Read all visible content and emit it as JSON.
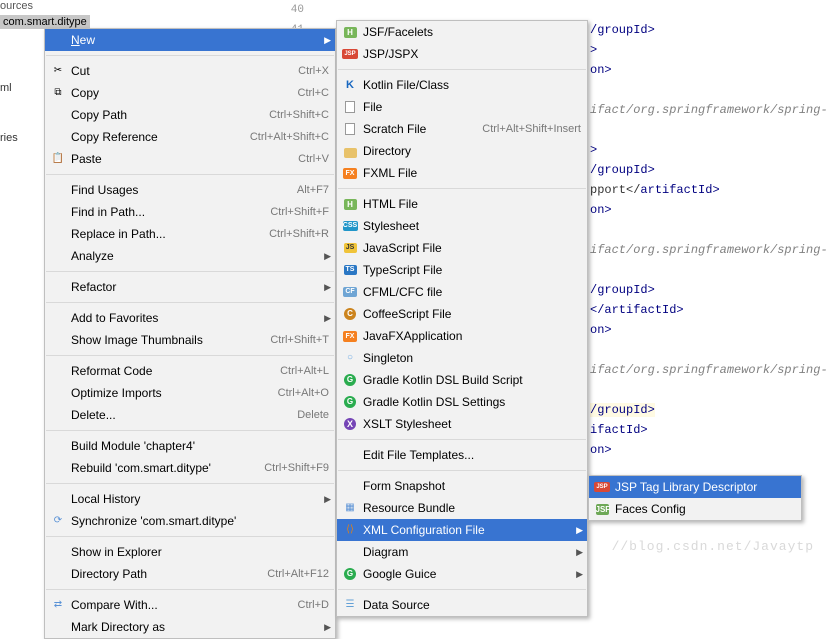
{
  "tree": {
    "sources": "ources",
    "selected_package": "com.smart.ditype",
    "side1": "ml",
    "side2": "ries"
  },
  "gutter": {
    "n40": "40",
    "n41": "41"
  },
  "code": {
    "l1": "/groupId>",
    "l2": ">",
    "l3": "on>",
    "c1": "ifact/org.springframework/spring-contex",
    "l4": ">",
    "l5": "/groupId>",
    "l6_a": "pport</",
    "l6_b": "artifactId",
    "l6_c": ">",
    "l7": "on>",
    "c2": "ifact/org.springframework/spring-webmvc",
    "l8": "/groupId>",
    "l9_a": "</",
    "l9_b": "artifactId",
    "l9_c": ">",
    "l10": "on>",
    "c3": "ifact/org.springframework/spring-beans",
    "l11_a": "/",
    "l11_b": "groupId",
    "l11_c": ">",
    "l12": "ifactId>",
    "l13": "on>",
    "wm": "//blog.csdn.net/Javaytp"
  },
  "menu1": {
    "new": "New",
    "cut": "Cut",
    "copy": "Copy",
    "copy_path": "Copy Path",
    "copy_ref": "Copy Reference",
    "paste": "Paste",
    "find_usages": "Find Usages",
    "find_in_path": "Find in Path...",
    "replace_in_path": "Replace in Path...",
    "analyze": "Analyze",
    "refactor": "Refactor",
    "add_fav": "Add to Favorites",
    "show_thumb": "Show Image Thumbnails",
    "reformat": "Reformat Code",
    "optimize": "Optimize Imports",
    "delete": "Delete...",
    "build": "Build Module 'chapter4'",
    "rebuild": "Rebuild 'com.smart.ditype'",
    "local_hist": "Local History",
    "sync": "Synchronize 'com.smart.ditype'",
    "show_exp": "Show in Explorer",
    "dir_path": "Directory Path",
    "compare": "Compare With...",
    "mark_dir": "Mark Directory as",
    "sc_cut": "Ctrl+X",
    "sc_copy": "Ctrl+C",
    "sc_copy_path": "Ctrl+Shift+C",
    "sc_copy_ref": "Ctrl+Alt+Shift+C",
    "sc_paste": "Ctrl+V",
    "sc_find_usages": "Alt+F7",
    "sc_find_in_path": "Ctrl+Shift+F",
    "sc_replace_in_path": "Ctrl+Shift+R",
    "sc_show_thumb": "Ctrl+Shift+T",
    "sc_reformat": "Ctrl+Alt+L",
    "sc_optimize": "Ctrl+Alt+O",
    "sc_delete": "Delete",
    "sc_rebuild": "Ctrl+Shift+F9",
    "sc_dir_path": "Ctrl+Alt+F12",
    "sc_compare": "Ctrl+D"
  },
  "menu2": {
    "jsf": "JSF/Facelets",
    "jsp": "JSP/JSPX",
    "kotlin": "Kotlin File/Class",
    "file": "File",
    "scratch": "Scratch File",
    "dir": "Directory",
    "fxml": "FXML File",
    "html": "HTML File",
    "style": "Stylesheet",
    "js": "JavaScript File",
    "ts": "TypeScript File",
    "cfml": "CFML/CFC file",
    "coffee": "CoffeeScript File",
    "jfx": "JavaFXApplication",
    "singleton": "Singleton",
    "gkbs": "Gradle Kotlin DSL Build Script",
    "gks": "Gradle Kotlin DSL Settings",
    "xslt": "XSLT Stylesheet",
    "edit_tpl": "Edit File Templates...",
    "snapshot": "Form Snapshot",
    "bundle": "Resource Bundle",
    "xmlcfg": "XML Configuration File",
    "diagram": "Diagram",
    "guice": "Google Guice",
    "datasource": "Data Source",
    "sc_scratch": "Ctrl+Alt+Shift+Insert"
  },
  "menu3": {
    "tld": "JSP Tag Library Descriptor",
    "faces": "Faces Config"
  }
}
